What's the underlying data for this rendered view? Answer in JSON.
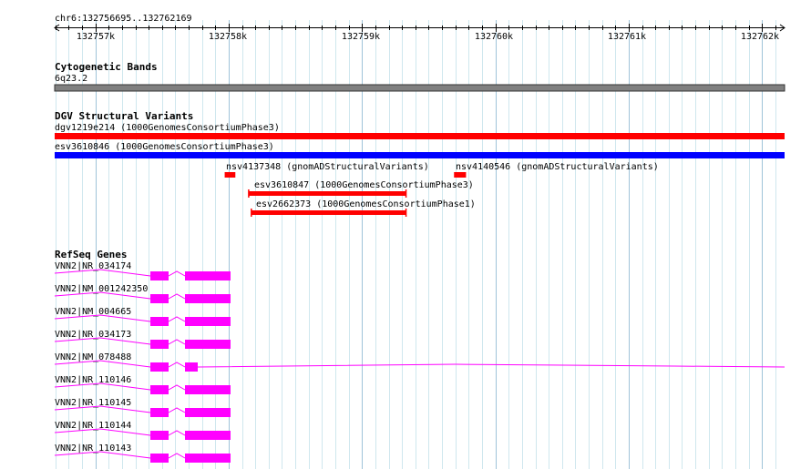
{
  "coordinate": "chr6:132756695..132762169",
  "ruler": {
    "ticks": [
      "132757k",
      "132758k",
      "132759k",
      "132760k",
      "132761k",
      "132762k"
    ],
    "tick_positions_bp": [
      132757000,
      132758000,
      132759000,
      132760000,
      132761000,
      132762000
    ]
  },
  "range_bp": {
    "start": 132756695,
    "end": 132762169
  },
  "tracks": {
    "cytoband": {
      "title": "Cytogenetic Bands",
      "band_label": "6q23.2",
      "color": "#808080"
    },
    "dgv": {
      "title": "DGV Structural Variants",
      "features": [
        {
          "label": "dgv1219e214 (1000GenomesConsortiumPhase3)",
          "start": 132756695,
          "end": 132762169,
          "color": "#ff0000",
          "type": "bar"
        },
        {
          "label": "esv3610846 (1000GenomesConsortiumPhase3)",
          "start": 132756695,
          "end": 132762169,
          "color": "#0000ff",
          "type": "bar"
        },
        {
          "label": "nsv4137348 (gnomADStructuralVariants)",
          "start": 132757970,
          "end": 132758050,
          "color": "#ff0000",
          "type": "bar"
        },
        {
          "label": "nsv4140546 (gnomADStructuralVariants)",
          "start": 132759690,
          "end": 132759780,
          "color": "#ff0000",
          "type": "bar"
        },
        {
          "label": "esv3610847 (1000GenomesConsortiumPhase3)",
          "start": 132758150,
          "end": 132759330,
          "color": "#ff0000",
          "type": "bar-bracket"
        },
        {
          "label": "esv2662373 (1000GenomesConsortiumPhase1)",
          "start": 132758170,
          "end": 132759330,
          "color": "#ff0000",
          "type": "bar-bracket"
        }
      ]
    },
    "refseq": {
      "title": "RefSeq Genes",
      "color": "#ff00ff",
      "transcripts": [
        {
          "label": "VNN2|NR_034174"
        },
        {
          "label": "VNN2|NM_001242350"
        },
        {
          "label": "VNN2|NM_004665"
        },
        {
          "label": "VNN2|NR_034173"
        },
        {
          "label": "VNN2|NM_078488"
        },
        {
          "label": "VNN2|NR_110146"
        },
        {
          "label": "VNN2|NR_110145"
        },
        {
          "label": "VNN2|NR_110144"
        },
        {
          "label": "VNN2|NR_110143"
        }
      ]
    }
  }
}
